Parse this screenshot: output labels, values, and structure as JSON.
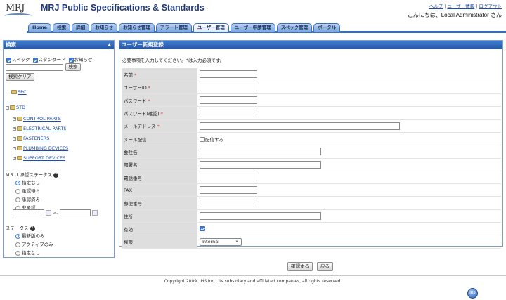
{
  "header": {
    "logo_text": "MRJ",
    "title": "MRJ Public Specifications & Standards",
    "links": [
      "ヘルプ",
      "ユーザー情報",
      "ログアウト"
    ],
    "greeting": "こんにちは、Local Administrator さん"
  },
  "nav": {
    "tabs": [
      "Home",
      "検索",
      "詳細",
      "お知らせ",
      "お知らせ管理",
      "アラート管理",
      "ユーザー管理",
      "ユーザー申請管理",
      "スペック管理",
      "ポータル"
    ],
    "active": "ユーザー管理"
  },
  "sidebar": {
    "title": "検索",
    "filters": [
      {
        "label": "スペック",
        "checked": true
      },
      {
        "label": "スタンダード",
        "checked": true
      },
      {
        "label": "お知らせ",
        "checked": true
      }
    ],
    "search_button": "検索",
    "clear_button": "検索クリア",
    "tree": {
      "spc": "SPC",
      "std": "STD",
      "std_children": [
        "CONTROL PARTS",
        "ELECTRICAL PARTS",
        "FASTENERS",
        "PLUMBING DEVICES",
        "SUPPORT DEVICES"
      ]
    },
    "approval": {
      "label": "MＲＪ 承認ステータス",
      "options": [
        "指定なし",
        "承認待ち",
        "承認済み",
        "非承認"
      ],
      "selected": "指定なし",
      "range_sep": "〜"
    },
    "status": {
      "label": "ステータス",
      "options": [
        "最新版のみ",
        "アクティブのみ",
        "指定なし"
      ],
      "selected": "最新版のみ"
    }
  },
  "main": {
    "title": "ユーザー新規登録",
    "note": "必要事項を入力してください。*は入力必須です。",
    "fields": [
      {
        "label": "名前",
        "required": true,
        "type": "text",
        "value": ""
      },
      {
        "label": "ユーザーID",
        "required": true,
        "type": "text",
        "value": ""
      },
      {
        "label": "パスワード",
        "required": true,
        "type": "text",
        "value": ""
      },
      {
        "label": "パスワード(確認)",
        "required": true,
        "type": "text",
        "value": ""
      },
      {
        "label": "メールアドレス",
        "required": true,
        "type": "text",
        "value": ""
      },
      {
        "label": "メール配信",
        "required": false,
        "type": "checkbox",
        "option_label": "配信する",
        "checked": false
      },
      {
        "label": "会社名",
        "required": false,
        "type": "text",
        "value": ""
      },
      {
        "label": "部署名",
        "required": false,
        "type": "text",
        "value": ""
      },
      {
        "label": "電話番号",
        "required": false,
        "type": "text",
        "value": ""
      },
      {
        "label": "FAX",
        "required": false,
        "type": "text",
        "value": ""
      },
      {
        "label": "郵便番号",
        "required": false,
        "type": "text",
        "value": ""
      },
      {
        "label": "住所",
        "required": false,
        "type": "text",
        "value": ""
      },
      {
        "label": "有効",
        "required": false,
        "type": "checkbox",
        "checked": true
      },
      {
        "label": "権限",
        "required": false,
        "type": "select",
        "value": "Internal"
      }
    ],
    "required_mark": "*",
    "confirm_button": "確認する",
    "back_button": "戻る"
  },
  "footer": {
    "copyright": "Copyright 2009, IHS Inc., its subsidiary and affiliated companies, all rights reserved.",
    "badge": "IHS"
  },
  "colors": {
    "accent": "#2458a8",
    "tab": "#8fb2e2",
    "label_bg": "#dedede"
  }
}
